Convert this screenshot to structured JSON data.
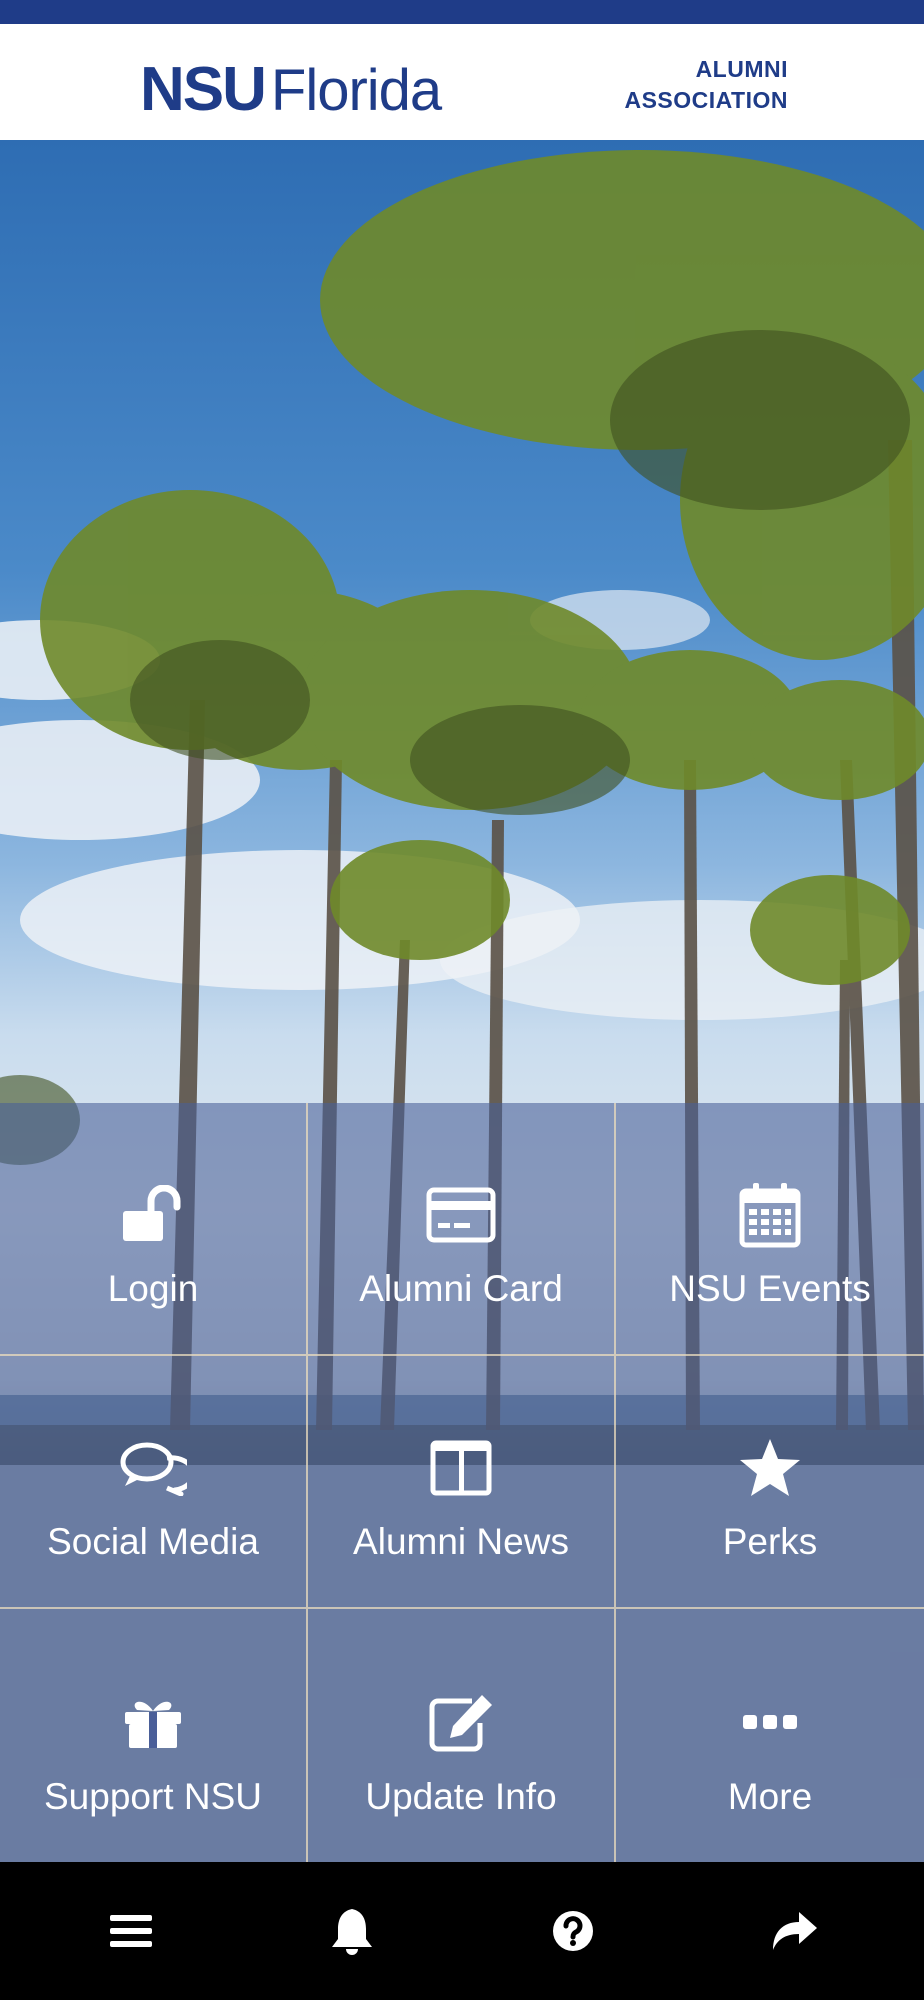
{
  "header": {
    "logo_nsu": "NSU",
    "logo_florida": "Florida",
    "assoc_line1": "ALUMNI",
    "assoc_line2": "ASSOCIATION",
    "brand_color": "#1f3c88"
  },
  "tiles": [
    {
      "label": "Login",
      "icon": "unlock-icon"
    },
    {
      "label": "Alumni Card",
      "icon": "card-icon"
    },
    {
      "label": "NSU Events",
      "icon": "calendar-icon"
    },
    {
      "label": "Social Media",
      "icon": "chat-bubbles-icon"
    },
    {
      "label": "Alumni News",
      "icon": "columns-icon"
    },
    {
      "label": "Perks",
      "icon": "star-icon"
    },
    {
      "label": "Support NSU",
      "icon": "gift-icon"
    },
    {
      "label": "Update Info",
      "icon": "edit-icon"
    },
    {
      "label": "More",
      "icon": "ellipsis-icon"
    }
  ],
  "bottom_nav": [
    {
      "icon": "menu-icon"
    },
    {
      "icon": "bell-icon"
    },
    {
      "icon": "help-icon"
    },
    {
      "icon": "share-icon"
    }
  ]
}
